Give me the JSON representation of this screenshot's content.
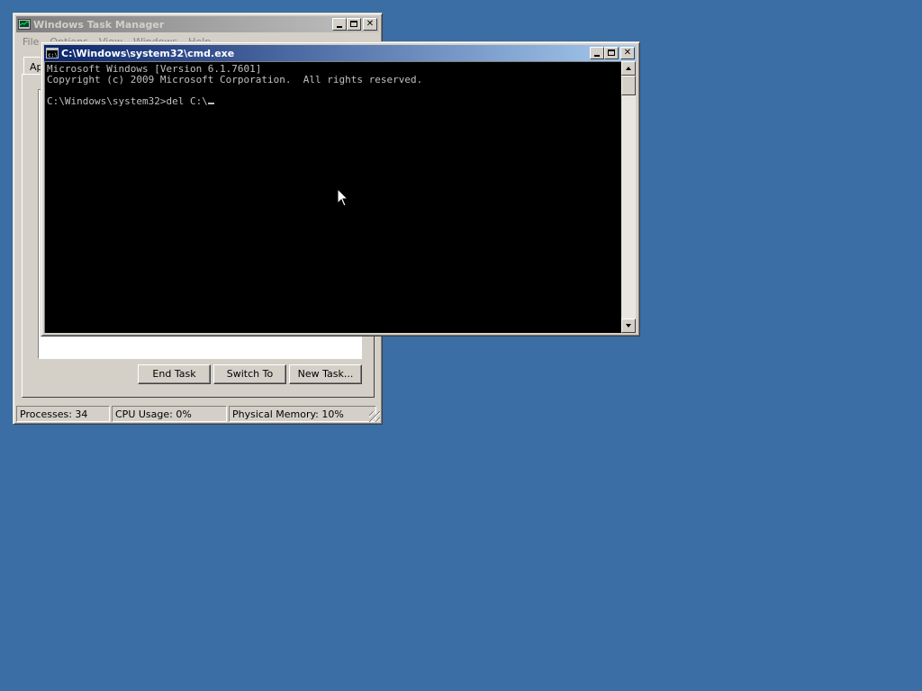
{
  "desktop": {
    "background": "#3a6ea5"
  },
  "taskmgr": {
    "title": "Windows Task Manager",
    "menu": [
      "File",
      "Options",
      "View",
      "Windows",
      "Help"
    ],
    "tab_partial": "Ap",
    "buttons": {
      "end_task": "End Task",
      "switch_to": "Switch To",
      "new_task": "New Task..."
    },
    "status": {
      "processes": "Processes: 34",
      "cpu": "CPU Usage: 0%",
      "memory": "Physical Memory: 10%"
    }
  },
  "cmd": {
    "title": "C:\\Windows\\system32\\cmd.exe",
    "lines": [
      "Microsoft Windows [Version 6.1.7601]",
      "Copyright (c) 2009 Microsoft Corporation.  All rights reserved.",
      "",
      "C:\\Windows\\system32>del C:\\"
    ],
    "colors": {
      "background": "#000000",
      "text": "#c0c0c0",
      "title_active": "#0a246a"
    }
  }
}
